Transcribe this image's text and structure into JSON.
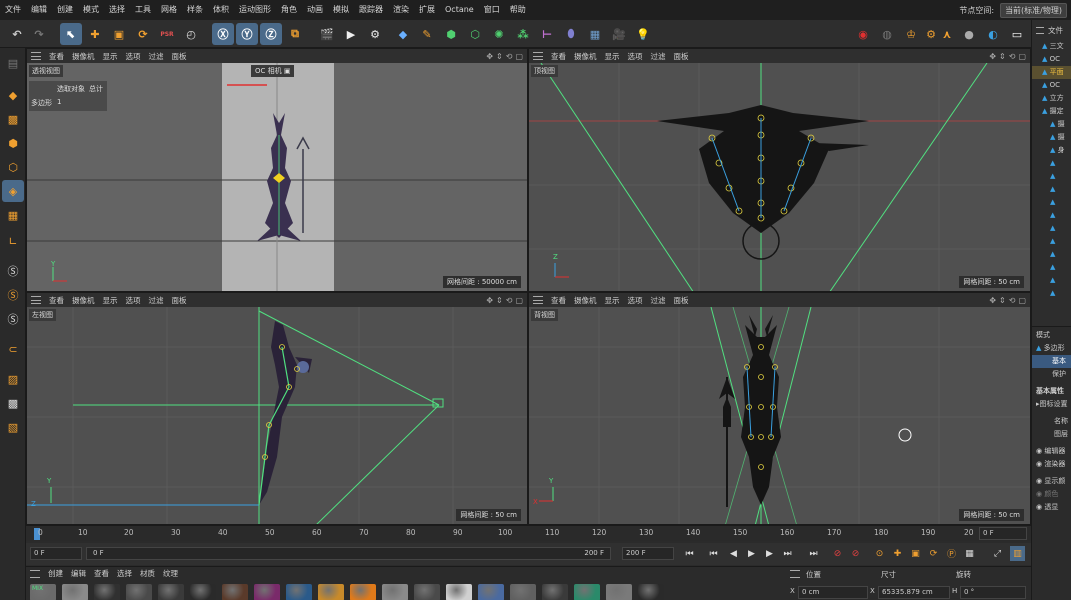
{
  "menubar": {
    "items": [
      "文件",
      "编辑",
      "创建",
      "模式",
      "选择",
      "工具",
      "网格",
      "样条",
      "体积",
      "运动图形",
      "角色",
      "动画",
      "模拟",
      "跟踪器",
      "渲染",
      "扩展",
      "Octane",
      "窗口",
      "帮助"
    ],
    "node_space_label": "节点空间:",
    "layout_value": "当前(标准/物理)"
  },
  "viewports": {
    "menu": [
      "查看",
      "摄像机",
      "显示",
      "选项",
      "过滤",
      "面板"
    ],
    "perspective": {
      "title": "透视视图",
      "camera_label": "OC 相机",
      "info_label": "选取对象",
      "info_total": "总计",
      "poly_label": "多边形",
      "poly_value": "1",
      "grid": "网格间距 : 50000 cm"
    },
    "top": {
      "title": "顶视图",
      "grid": "网格间距 : 50 cm"
    },
    "left": {
      "title": "左视图",
      "grid": "网格间距 : 50 cm"
    },
    "back": {
      "title": "背视图",
      "grid": "网格间距 : 50 cm"
    }
  },
  "timeline": {
    "ticks": [
      "0",
      "10",
      "20",
      "30",
      "40",
      "50",
      "60",
      "70",
      "80",
      "90",
      "100",
      "110",
      "120",
      "130",
      "140",
      "150",
      "160",
      "170",
      "180",
      "190",
      "20"
    ],
    "right_field": "0 F"
  },
  "playbar": {
    "current": "0 F",
    "start": "0 F",
    "end": "200 F",
    "end2": "200 F"
  },
  "materials": {
    "menu": [
      "创建",
      "编辑",
      "查看",
      "选择",
      "材质",
      "纹理"
    ],
    "swatch_colors": [
      "#6a6a6a",
      "#8a8a8a",
      "#303030",
      "#4a4a4a",
      "#3a3a3a",
      "#2a2a2a",
      "#5a3a2a",
      "#7a2a6a",
      "#2a5a8a",
      "#c88a2a",
      "#e07a1a",
      "#8a8a8a",
      "#4a4a4a",
      "#d0d0d0",
      "#4a6aa0",
      "#606060",
      "#3a3a3a",
      "#2a8a6a",
      "#7a7a7a",
      "#2a2a2a"
    ],
    "mix_label": "MIX"
  },
  "coords": {
    "position_label": "位置",
    "size_label": "尺寸",
    "rotation_label": "旋转",
    "x_label": "X",
    "x_value": "0 cm",
    "size_x_label": "X",
    "size_x_value": "65335.879 cm",
    "h_label": "H",
    "h_value": "0 °"
  },
  "rightpanel": {
    "tabs": [
      "文件"
    ],
    "objects": [
      "三文",
      "OC",
      "平面",
      "OC",
      "立方",
      "摄定",
      "摄",
      "摄",
      "身",
      "",
      "",
      "",
      "",
      "",
      "",
      "",
      "",
      "",
      "",
      ""
    ],
    "attr_header": "模式",
    "attr_object": "多边形",
    "attr_tab1": "基本",
    "attr_tab2": "保护",
    "basic_props": "基本属性",
    "icon_settings": "▸图标设置",
    "name_label": "名称",
    "layer_label": "图层",
    "editor_label": "编辑器",
    "render_label": "渲染器",
    "display_color_label": "显示颜",
    "color_label": "颜色",
    "transparency_label": "透显"
  }
}
